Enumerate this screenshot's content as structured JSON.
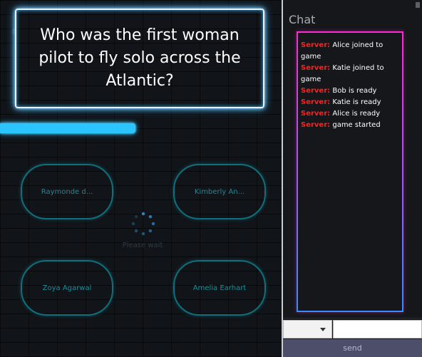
{
  "game": {
    "question": "Who was the first woman pilot to fly solo across the Atlantic?",
    "timer": {
      "fraction": 0.48
    },
    "answers": [
      {
        "label": "Raymonde d..."
      },
      {
        "label": "Kimberly An..."
      },
      {
        "label": "Zoya Agarwal"
      },
      {
        "label": "Amelia Earhart"
      }
    ],
    "loading": {
      "text": "Please wait",
      "icon": "spinner-icon"
    }
  },
  "chat": {
    "title": "Chat",
    "messages": [
      {
        "sender": "Server:",
        "text": "Alice joined to game"
      },
      {
        "sender": "Server:",
        "text": "Katie joined to game"
      },
      {
        "sender": "Server:",
        "text": "Bob is ready"
      },
      {
        "sender": "Server:",
        "text": "Katie is ready"
      },
      {
        "sender": "Server:",
        "text": "Alice is ready"
      },
      {
        "sender": "Server:",
        "text": "game started"
      }
    ],
    "recipient_value": "",
    "message_value": "",
    "send_label": "send"
  },
  "colors": {
    "accent": "#2cc4ff",
    "answer_border": "#0f6f7c",
    "answer_text": "#1d8a96",
    "chat_sender": "#ff2020",
    "chat_border_top": "#ff2bd4",
    "chat_border_bottom": "#3a8bff"
  }
}
